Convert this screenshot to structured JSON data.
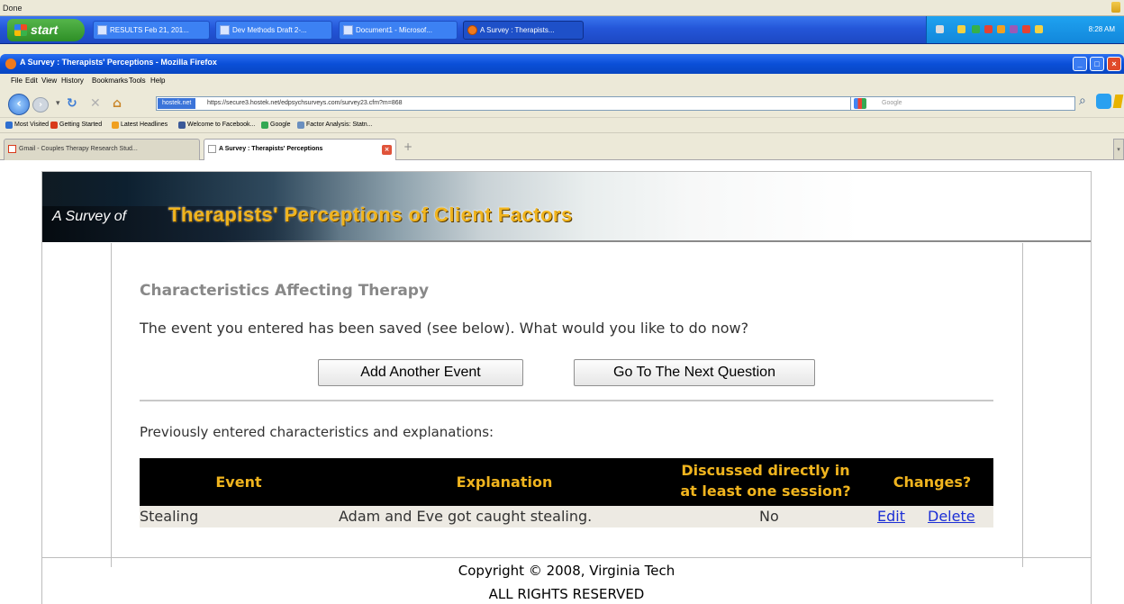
{
  "status_bar": {
    "text": "Done"
  },
  "taskbar": {
    "start_label": "start",
    "tasks": [
      {
        "label": "RESULTS Feb 21, 201..."
      },
      {
        "label": "Dev Methods Draft 2-..."
      },
      {
        "label": "Document1 - Microsof..."
      },
      {
        "label": "A Survey : Therapists..."
      }
    ],
    "clock": "8:28 AM"
  },
  "window": {
    "title": "A Survey : Therapists' Perceptions - Mozilla Firefox"
  },
  "menu": [
    "File",
    "Edit",
    "View",
    "History",
    "Bookmarks",
    "Tools",
    "Help"
  ],
  "navbar": {
    "url_badge": "hostek.net",
    "url": "https://secure3.hostek.net/edpsychsurveys.com/survey23.cfm?m=868",
    "search_placeholder": "Google"
  },
  "bookmarks": [
    {
      "label": "Most Visited",
      "color": "#2f6fd0"
    },
    {
      "label": "Getting Started",
      "color": "#d93a1a"
    },
    {
      "label": "Latest Headlines",
      "color": "#f0a020"
    },
    {
      "label": "Welcome to Facebook...",
      "color": "#3b5998"
    },
    {
      "label": "Google",
      "color": "#34a853"
    },
    {
      "label": "Factor Analysis: Statn...",
      "color": "#6a8fbf"
    }
  ],
  "tabs": [
    {
      "label": "Gmail - Couples Therapy Research Stud..."
    },
    {
      "label": "A Survey : Therapists' Perceptions"
    }
  ],
  "page": {
    "banner_prefix": "A Survey of",
    "banner_title": "Therapists' Perceptions of Client Factors",
    "heading": "Characteristics Affecting Therapy",
    "message": "The event you entered has been saved (see below). What would you like to do now?",
    "buttons": {
      "add": "Add Another Event",
      "next": "Go To The Next Question"
    },
    "previous_label": "Previously entered characteristics and explanations:",
    "table": {
      "headers": {
        "event": "Event",
        "explanation": "Explanation",
        "discussed_line1": "Discussed directly in",
        "discussed_line2": "at least one session?",
        "changes": "Changes?"
      },
      "rows": [
        {
          "event": "Stealing",
          "explanation": "Adam and Eve got caught stealing.",
          "discussed": "No",
          "edit": "Edit",
          "delete": "Delete"
        }
      ]
    },
    "footer": {
      "copyright": "Copyright © 2008, Virginia Tech",
      "rights": "ALL RIGHTS RESERVED"
    }
  }
}
